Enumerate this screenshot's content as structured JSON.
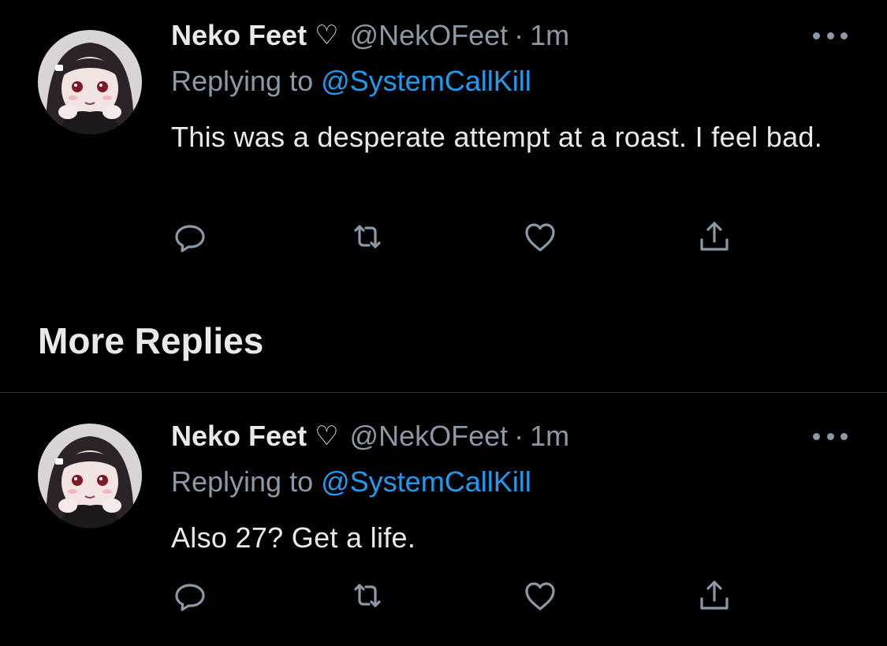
{
  "tweets": [
    {
      "name": "Neko Feet",
      "heart": "♡",
      "handle": "@NekOFeet",
      "separator": "·",
      "time": "1m",
      "replying_prefix": "Replying to",
      "replying_to": "@SystemCallKill",
      "text": "This was a desperate attempt at a roast. I feel bad."
    },
    {
      "name": "Neko Feet",
      "heart": "♡",
      "handle": "@NekOFeet",
      "separator": "·",
      "time": "1m",
      "replying_prefix": "Replying to",
      "replying_to": "@SystemCallKill",
      "text": "Also 27? Get a life."
    }
  ],
  "section": {
    "title": "More Replies"
  },
  "icons": {
    "more": "more-icon",
    "reply": "reply-icon",
    "retweet": "retweet-icon",
    "like": "like-icon",
    "share": "share-icon"
  },
  "colors": {
    "background": "#000000",
    "text": "#e7e9ea",
    "secondary": "#8b98a5",
    "accent": "#1d9bf0",
    "divider": "#2f3336"
  }
}
